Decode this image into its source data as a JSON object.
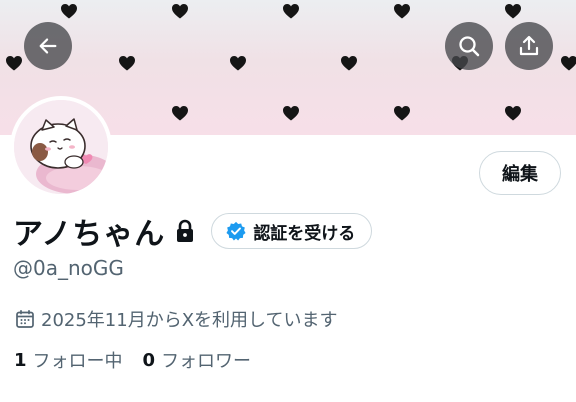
{
  "profile": {
    "display_name": "アノちゃん",
    "handle": "@0a_noGG",
    "joined": "2025年11月からXを利用しています",
    "following_count": "1",
    "following_label": "フォロー中",
    "followers_count": "0",
    "followers_label": "フォロワー",
    "locked": true
  },
  "buttons": {
    "edit_label": "編集",
    "verify_label": "認証を受ける"
  },
  "icons": {
    "back": "arrow-left-icon",
    "search": "search-icon",
    "share": "share-icon",
    "lock": "lock-icon",
    "verified": "verified-badge-icon",
    "calendar": "calendar-icon"
  },
  "colors": {
    "verified_blue": "#1d9bf0",
    "secondary_text": "#536471",
    "primary_text": "#0f1419"
  }
}
